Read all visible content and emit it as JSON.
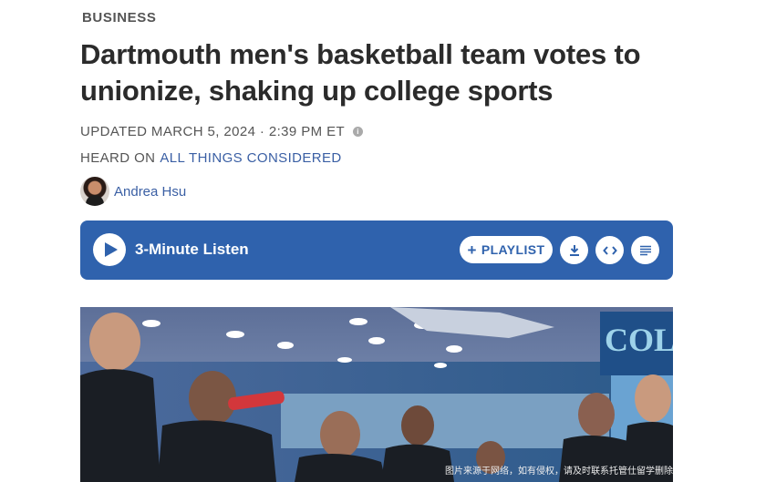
{
  "article": {
    "section": "BUSINESS",
    "headline": "Dartmouth men's basketball team votes to unionize, shaking up college sports",
    "updated": "UPDATED MARCH 5, 2024 · 2:39 PM ET",
    "heard_on_prefix": "HEARD ON",
    "heard_on_program": "ALL THINGS CONSIDERED",
    "author": "Andrea Hsu"
  },
  "player": {
    "listen_label": "3-Minute Listen",
    "playlist_label": "PLAYLIST"
  },
  "photo": {
    "overlay_text": "图片来源于网络，如有侵权，请及时联系托管仕留学删除",
    "jersey_text": "COL"
  },
  "colors": {
    "player_bg": "#2f62ad",
    "link": "#3a5fa4"
  }
}
